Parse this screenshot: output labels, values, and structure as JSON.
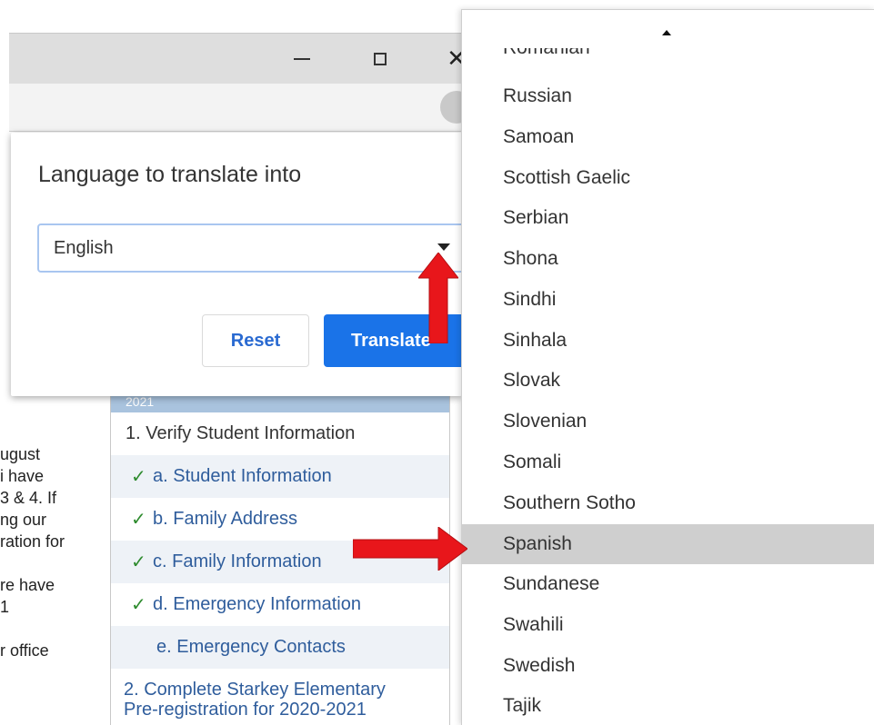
{
  "window": {
    "minimize_icon": "minimize-icon",
    "maximize_icon": "maximize-icon",
    "close_glyph": "✕"
  },
  "page": {
    "left_text": [
      "ugust",
      "i have",
      "3 & 4. If",
      "ng our",
      "ration for",
      "",
      "re have",
      "1",
      "",
      "r office"
    ],
    "nav_header": "2021",
    "nav_items": [
      {
        "label": "1. Verify Student Information",
        "checked": false
      },
      {
        "label": "a. Student Information",
        "checked": true
      },
      {
        "label": "b. Family Address",
        "checked": true
      },
      {
        "label": "c. Family Information",
        "checked": true
      },
      {
        "label": "d. Emergency Information",
        "checked": true
      },
      {
        "label": "e. Emergency Contacts",
        "checked": false
      }
    ],
    "nav_item_2_line1": "2. Complete Starkey Elementary",
    "nav_item_2_line2": "Pre-registration for 2020-2021"
  },
  "popup": {
    "title": "Language to translate into",
    "selected_language": "English",
    "reset_label": "Reset",
    "translate_label": "Translate"
  },
  "dropdown": {
    "partial_top": "Romanian",
    "options": [
      "Russian",
      "Samoan",
      "Scottish Gaelic",
      "Serbian",
      "Shona",
      "Sindhi",
      "Sinhala",
      "Slovak",
      "Slovenian",
      "Somali",
      "Southern Sotho",
      "Spanish",
      "Sundanese",
      "Swahili",
      "Swedish",
      "Tajik"
    ],
    "highlighted": "Spanish"
  },
  "colors": {
    "accent": "#1a73e8",
    "annotation_arrow": "#e8161b",
    "highlight": "#cfcfcf"
  }
}
